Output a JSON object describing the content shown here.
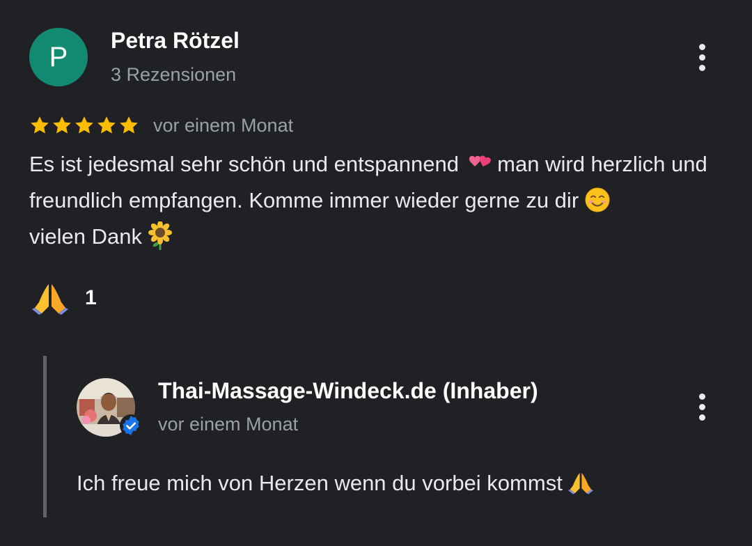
{
  "review": {
    "avatar_letter": "P",
    "reviewer_name": "Petra Rötzel",
    "reviewer_meta": "3 Rezensionen",
    "rating": 5,
    "rating_max": 5,
    "time": "vor einem Monat",
    "text_part1": "Es ist jedesmal sehr schön und entspannend ",
    "text_part2": " man wird herzlich und freundlich empfangen. Komme immer wieder gerne zu dir ",
    "text_part3": " vielen Dank ",
    "emojis": [
      "two-hearts",
      "smiling-face",
      "sunflower"
    ],
    "reaction_emoji": "folded-hands",
    "reaction_count": "1"
  },
  "reply": {
    "owner_name": "Thai-Massage-Windeck.de (Inhaber)",
    "time": "vor einem Monat",
    "text": "Ich freue mich von Herzen wenn du vorbei kommst ",
    "emoji": "folded-hands",
    "verified": true
  },
  "colors": {
    "background": "#202124",
    "avatar": "#138a72",
    "star": "#fbbc04",
    "secondary_text": "#9aa0a6",
    "verified": "#1a73e8",
    "reply_bar": "#5f6368"
  }
}
